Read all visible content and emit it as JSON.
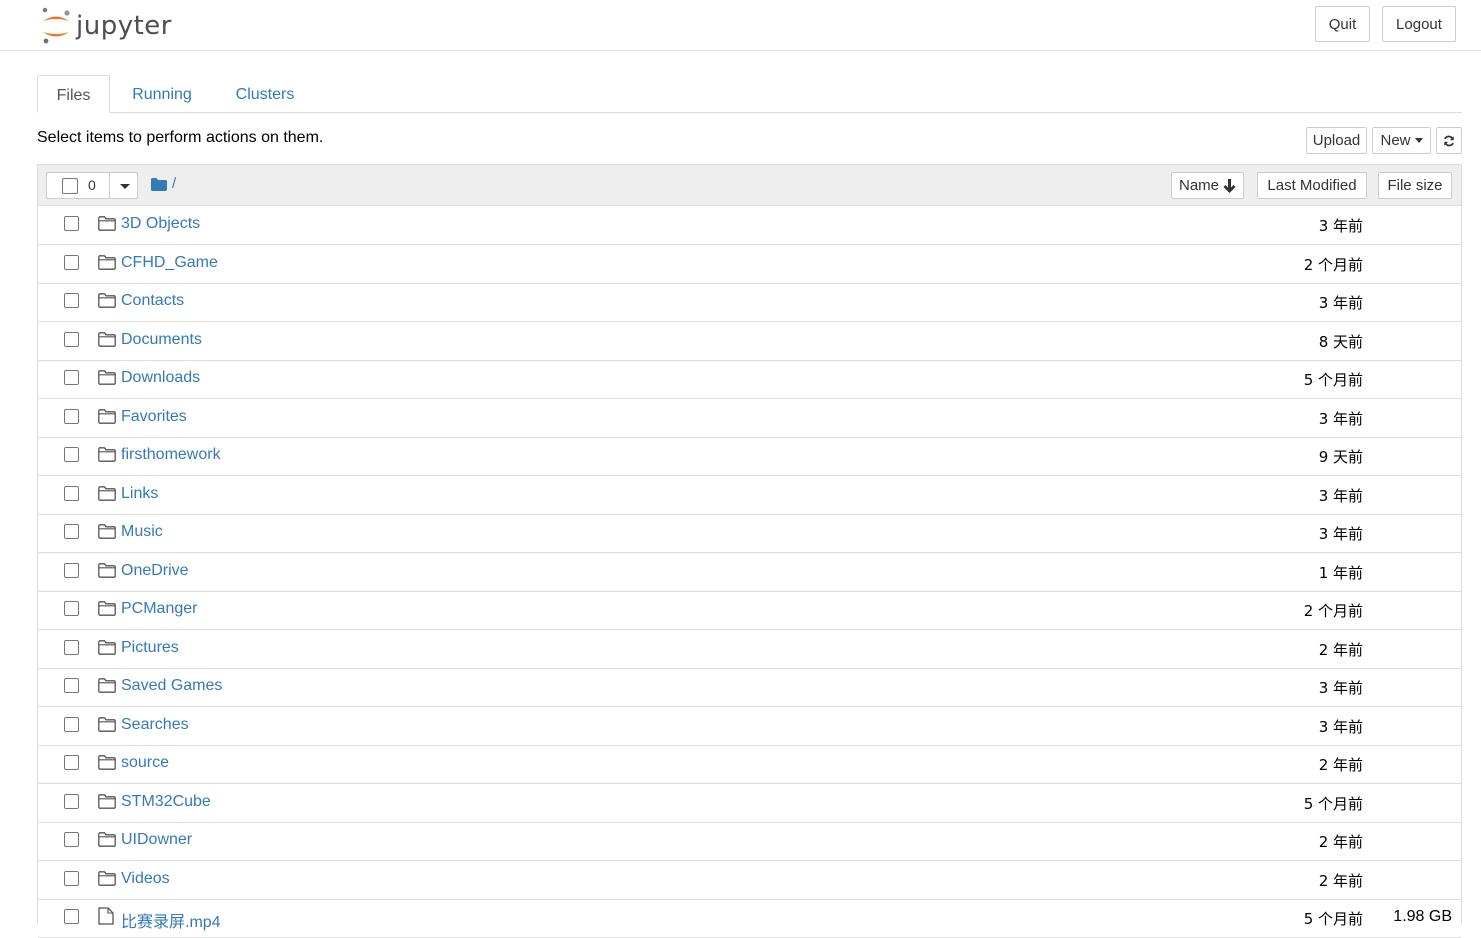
{
  "header": {
    "logo_text": "jupyter",
    "quit_label": "Quit",
    "logout_label": "Logout"
  },
  "tabs": [
    {
      "label": "Files",
      "active": true
    },
    {
      "label": "Running",
      "active": false
    },
    {
      "label": "Clusters",
      "active": false
    }
  ],
  "toolbar": {
    "info_text": "Select items to perform actions on them.",
    "upload_label": "Upload",
    "new_label": "New"
  },
  "list_header": {
    "selected_count": "0",
    "breadcrumb": "/",
    "sort_name_label": "Name",
    "sort_modified_label": "Last Modified",
    "sort_size_label": "File size"
  },
  "files": [
    {
      "name": "3D Objects",
      "type": "folder",
      "modified": "3 年前",
      "size": ""
    },
    {
      "name": "CFHD_Game",
      "type": "folder",
      "modified": "2 个月前",
      "size": ""
    },
    {
      "name": "Contacts",
      "type": "folder",
      "modified": "3 年前",
      "size": ""
    },
    {
      "name": "Documents",
      "type": "folder",
      "modified": "8 天前",
      "size": ""
    },
    {
      "name": "Downloads",
      "type": "folder",
      "modified": "5 个月前",
      "size": ""
    },
    {
      "name": "Favorites",
      "type": "folder",
      "modified": "3 年前",
      "size": ""
    },
    {
      "name": "firsthomework",
      "type": "folder",
      "modified": "9 天前",
      "size": ""
    },
    {
      "name": "Links",
      "type": "folder",
      "modified": "3 年前",
      "size": ""
    },
    {
      "name": "Music",
      "type": "folder",
      "modified": "3 年前",
      "size": ""
    },
    {
      "name": "OneDrive",
      "type": "folder",
      "modified": "1 年前",
      "size": ""
    },
    {
      "name": "PCManger",
      "type": "folder",
      "modified": "2 个月前",
      "size": ""
    },
    {
      "name": "Pictures",
      "type": "folder",
      "modified": "2 年前",
      "size": ""
    },
    {
      "name": "Saved Games",
      "type": "folder",
      "modified": "3 年前",
      "size": ""
    },
    {
      "name": "Searches",
      "type": "folder",
      "modified": "3 年前",
      "size": ""
    },
    {
      "name": "source",
      "type": "folder",
      "modified": "2 年前",
      "size": ""
    },
    {
      "name": "STM32Cube",
      "type": "folder",
      "modified": "5 个月前",
      "size": ""
    },
    {
      "name": "UIDowner",
      "type": "folder",
      "modified": "2 年前",
      "size": ""
    },
    {
      "name": "Videos",
      "type": "folder",
      "modified": "2 年前",
      "size": ""
    },
    {
      "name": "比赛录屏.mp4",
      "type": "file",
      "modified": "5 个月前",
      "size": "1.98 GB"
    }
  ],
  "colors": {
    "link": "#337ab7",
    "logo_orange": "#f37726",
    "border": "#dddddd"
  }
}
